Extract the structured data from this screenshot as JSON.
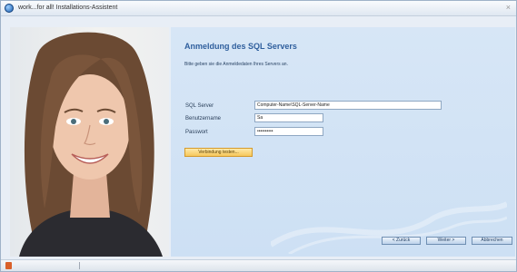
{
  "window": {
    "title": "work...for all! Installations-Assistent",
    "close_glyph": "×"
  },
  "photo": {
    "icon": "portrait-photo"
  },
  "panel": {
    "heading": "Anmeldung des SQL Servers",
    "intro": "Bitte geben sie die Anmeldedaten Ihres Servers an."
  },
  "form": {
    "sql_server": {
      "label": "SQL Server",
      "value": "Computer-Name\\SQL-Server-Name"
    },
    "username": {
      "label": "Benutzername",
      "value": "Sa"
    },
    "password": {
      "label": "Passwort",
      "value": "••••••••••"
    },
    "test_button": "Verbindung testen..."
  },
  "nav": {
    "back": "< Zurück",
    "next": "Weiter >",
    "cancel": "Abbrechen"
  },
  "colors": {
    "heading": "#2f5f9d",
    "panel": "#d7e6f6",
    "test_button": "#f6c75b"
  }
}
